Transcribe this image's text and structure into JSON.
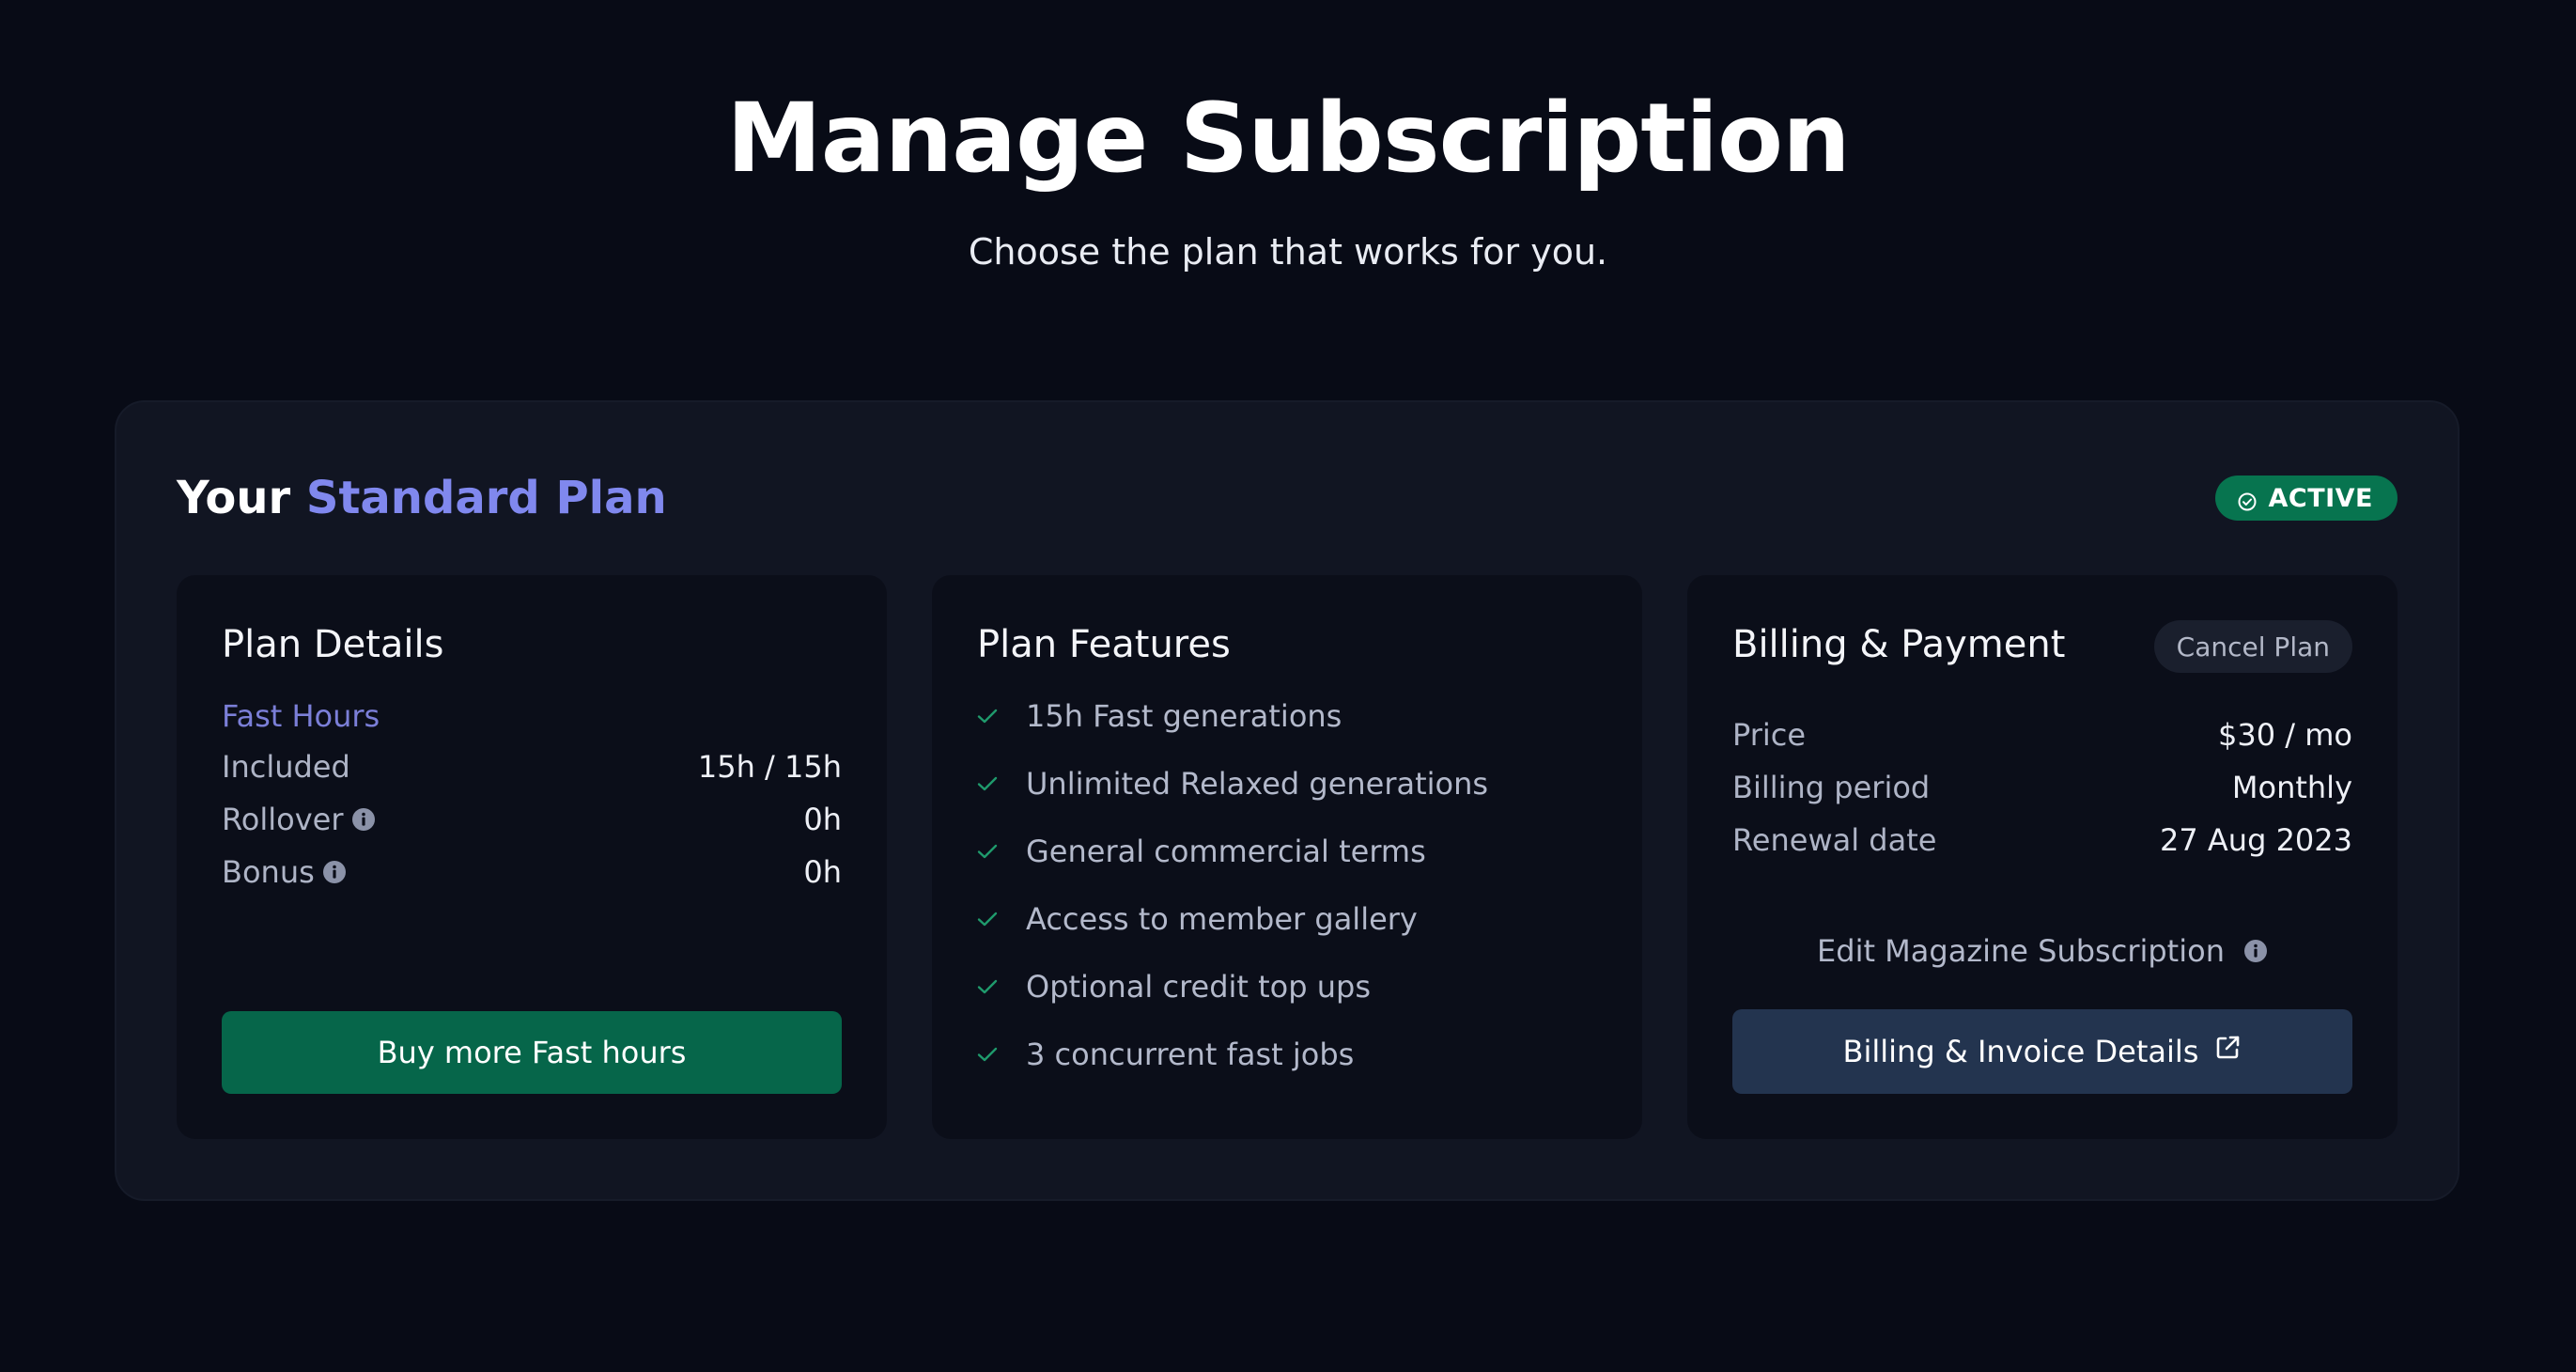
{
  "header": {
    "title": "Manage Subscription",
    "subtitle": "Choose the plan that works for you."
  },
  "plan": {
    "prefix": "Your",
    "name": "Standard Plan",
    "status": "ACTIVE"
  },
  "plan_details": {
    "title": "Plan Details",
    "section_label": "Fast Hours",
    "rows": [
      {
        "label": "Included",
        "value": "15h / 15h"
      },
      {
        "label": "Rollover",
        "value": "0h"
      },
      {
        "label": "Bonus",
        "value": "0h"
      }
    ],
    "button_label": "Buy more Fast hours"
  },
  "plan_features": {
    "title": "Plan Features",
    "items": [
      "15h Fast generations",
      "Unlimited Relaxed generations",
      "General commercial terms",
      "Access to member gallery",
      "Optional credit top ups",
      "3 concurrent fast jobs"
    ]
  },
  "billing": {
    "title": "Billing & Payment",
    "cancel_label": "Cancel Plan",
    "rows": [
      {
        "label": "Price",
        "value": "$30 / mo"
      },
      {
        "label": "Billing period",
        "value": "Monthly"
      },
      {
        "label": "Renewal date",
        "value": "27 Aug 2023"
      }
    ],
    "edit_link": "Edit Magazine Subscription",
    "button_label": "Billing & Invoice Details"
  },
  "colors": {
    "background": "#080b16",
    "panel": "#111522",
    "accent": "#8088ee",
    "success": "#07744f",
    "primary_button": "#06664a",
    "secondary_button": "#23344f"
  },
  "icons": {
    "status": "check-circle-icon",
    "info": "info-icon",
    "feature": "check-icon",
    "external": "external-link-icon"
  }
}
